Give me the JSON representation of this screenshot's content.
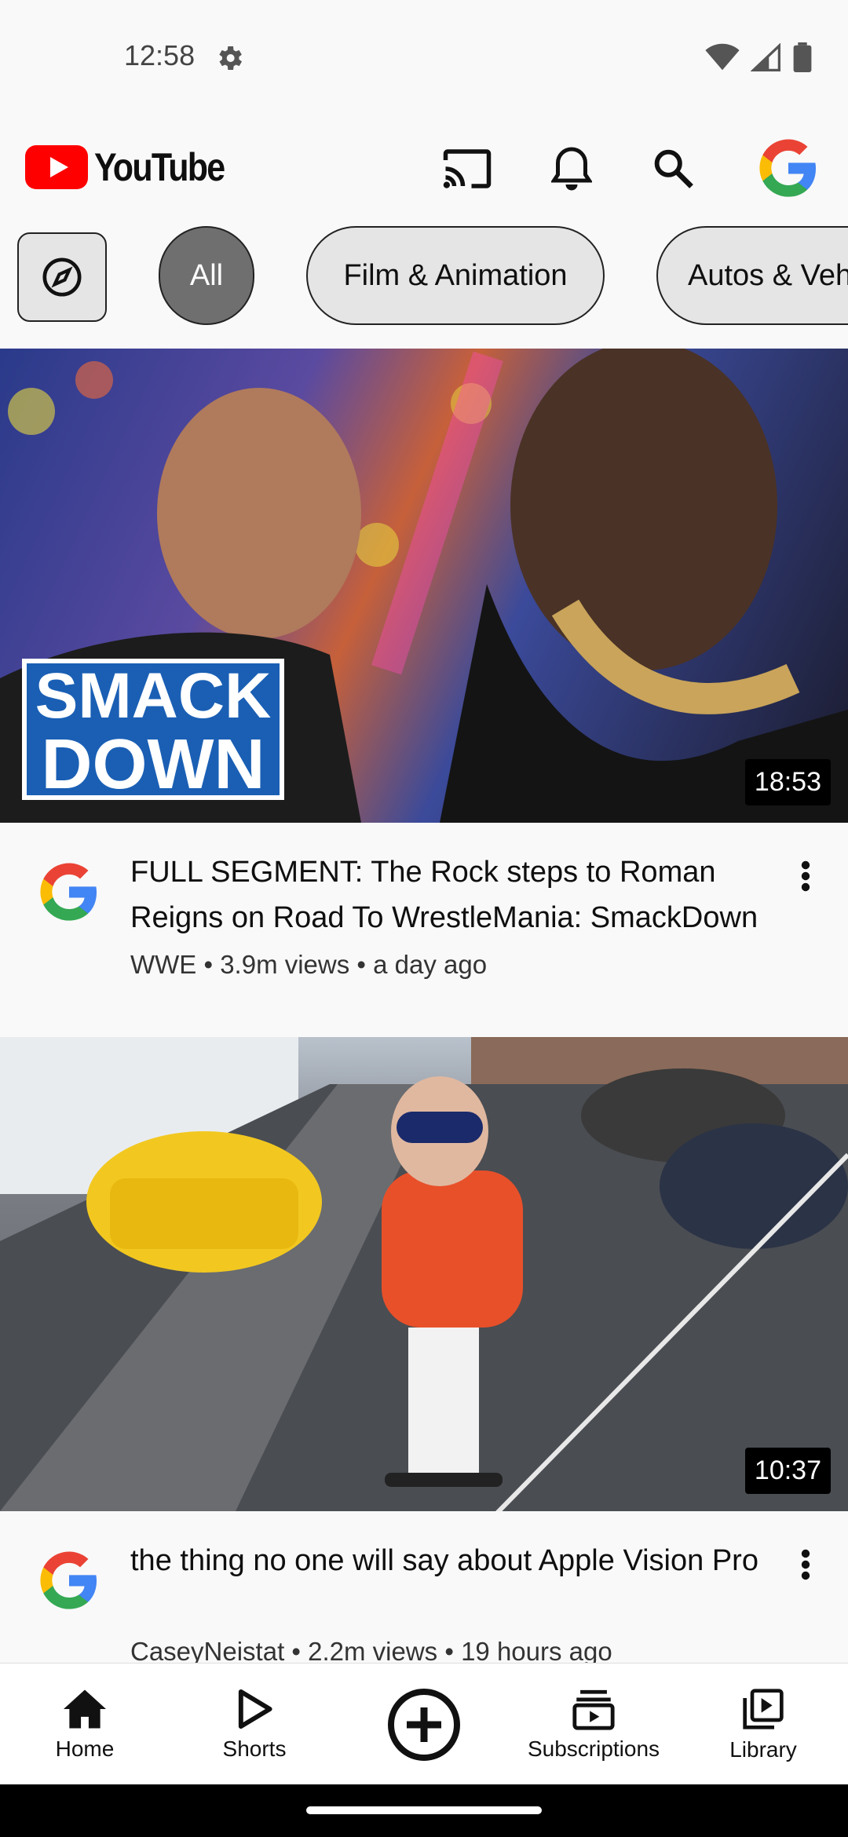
{
  "status": {
    "time": "12:58"
  },
  "app": {
    "logo_text": "YouTube"
  },
  "chips": {
    "all": "All",
    "film": "Film & Animation",
    "autos": "Autos & Vehicles"
  },
  "videos": [
    {
      "duration": "18:53",
      "thumb_text_1": "SMACK",
      "thumb_text_2": "DOWN",
      "title": "FULL SEGMENT: The Rock steps to Roman Reigns on Road To WrestleMania: SmackDown",
      "subtitle": "WWE • 3.9m views • a day ago"
    },
    {
      "duration": "10:37",
      "title": "the thing no one will say about Apple Vision Pro",
      "subtitle": "CaseyNeistat • 2.2m views • 19 hours ago"
    }
  ],
  "nav": {
    "home": "Home",
    "shorts": "Shorts",
    "subscriptions": "Subscriptions",
    "library": "Library"
  },
  "colors": {
    "accent": "#ff0000",
    "chip_selected": "#6f6f6f"
  }
}
